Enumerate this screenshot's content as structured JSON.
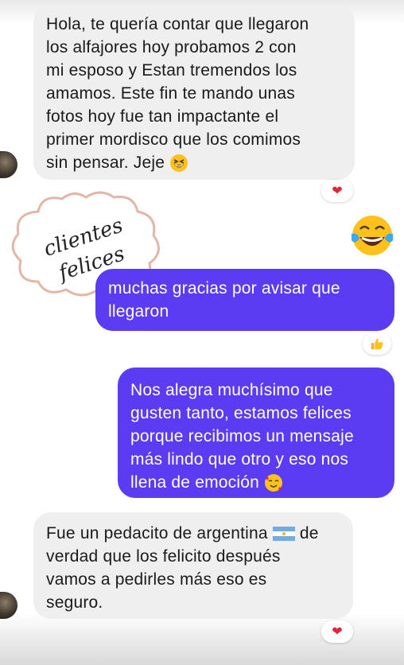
{
  "messages": [
    {
      "id": "m1",
      "text": "Hola, te quería contar que llegaron\nlos alfajores hoy probamos 2 con\nmi esposo y Estan tremendos los\namamos. Este fin te mando unas\nfotos hoy fue tan impactante el\nprimer mordisco que los comimos\nsin pensar. Jeje",
      "emoji": "grinning-squinting-face",
      "reaction": "red-heart"
    },
    {
      "id": "m2",
      "text": "muchas gracias por avisar que\nllegaron",
      "reaction": "thumbs-up"
    },
    {
      "id": "m3",
      "text": "Nos alegra muchísimo que\ngusten tanto, estamos felices\nporque recibimos un mensaje\nmás lindo que otro y eso nos\nllena de emoción",
      "emoji": "smiling-face-with-hearts"
    },
    {
      "id": "m4",
      "text_before_flag": "Fue un pedacito de argentina",
      "text_after_flag": " de\nverdad que los felicito después\nvamos a pedirles más eso es\nseguro.",
      "emoji": "argentina-flag",
      "reaction": "red-heart"
    }
  ],
  "sticker": {
    "line1": "clientes",
    "line2": "felices"
  },
  "laugh_emoji": "face-with-tears-of-joy",
  "colors": {
    "outgoing": "#5b3cf2",
    "incoming": "#efefef",
    "heart": "#e0263a"
  }
}
